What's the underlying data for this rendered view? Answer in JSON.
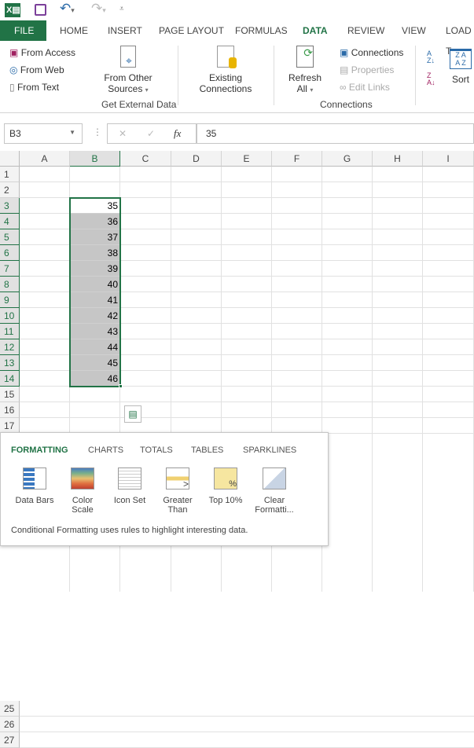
{
  "qat": {
    "app_icon": "excel-icon",
    "save": "save-icon",
    "undo": "undo-icon",
    "redo": "redo-icon",
    "customize": "customize-icon"
  },
  "tabs": [
    "FILE",
    "HOME",
    "INSERT",
    "PAGE LAYOUT",
    "FORMULAS",
    "DATA",
    "REVIEW",
    "VIEW",
    "LOAD T"
  ],
  "active_tab": "DATA",
  "ribbon": {
    "from_access": "From Access",
    "from_web": "From Web",
    "from_text": "From Text",
    "from_other_1": "From Other",
    "from_other_2": "Sources",
    "existing_1": "Existing",
    "existing_2": "Connections",
    "group_external": "Get External Data",
    "refresh_1": "Refresh",
    "refresh_2": "All",
    "connections": "Connections",
    "properties": "Properties",
    "edit_links": "Edit Links",
    "group_connections": "Connections",
    "sort": "Sort"
  },
  "formula_bar": {
    "name_box": "B3",
    "fx": "fx",
    "value": "35"
  },
  "columns": [
    "A",
    "B",
    "C",
    "D",
    "E",
    "F",
    "G",
    "H",
    "I"
  ],
  "rows": [
    "1",
    "2",
    "3",
    "4",
    "5",
    "6",
    "7",
    "8",
    "9",
    "10",
    "11",
    "12",
    "13",
    "14",
    "15",
    "16",
    "17",
    "25",
    "26",
    "27"
  ],
  "column_b_values": [
    "35",
    "36",
    "37",
    "38",
    "39",
    "40",
    "41",
    "42",
    "43",
    "44",
    "45",
    "46"
  ],
  "selection_color": "#217346",
  "quick_analysis": {
    "tabs": [
      "FORMATTING",
      "CHARTS",
      "TOTALS",
      "TABLES",
      "SPARKLINES"
    ],
    "active": "FORMATTING",
    "options": [
      {
        "l1": "Data Bars",
        "l2": ""
      },
      {
        "l1": "Color",
        "l2": "Scale"
      },
      {
        "l1": "Icon Set",
        "l2": ""
      },
      {
        "l1": "Greater",
        "l2": "Than"
      },
      {
        "l1": "Top 10%",
        "l2": ""
      },
      {
        "l1": "Clear",
        "l2": "Formatti..."
      }
    ],
    "description": "Conditional Formatting uses rules to highlight interesting data."
  }
}
